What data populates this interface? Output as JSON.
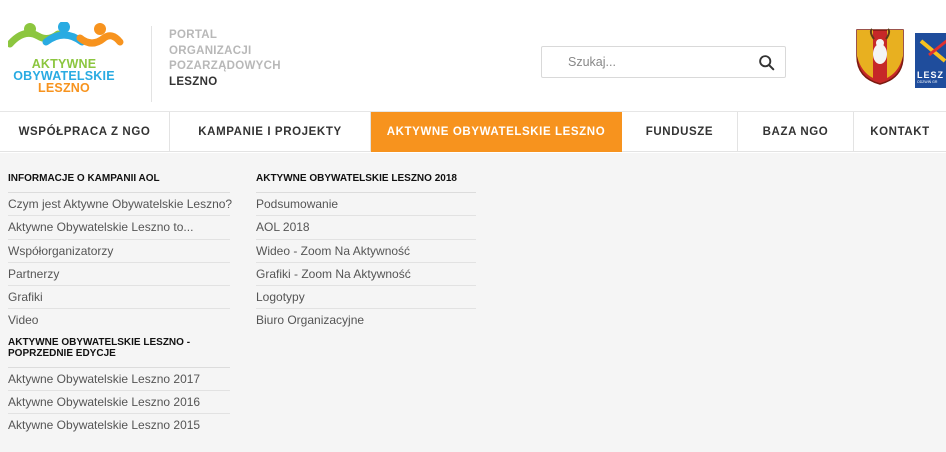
{
  "logo": {
    "line1": "AKTYWNE",
    "line2": "OBYWATELSKIE",
    "line3": "LESZNO",
    "colors": {
      "green": "#8cc63f",
      "blue": "#29abe2",
      "orange": "#f7931e"
    }
  },
  "portal": {
    "line1": "PORTAL",
    "line2": "ORGANIZACJI",
    "line3": "POZARZĄDOWYCH",
    "line4": "LESZNO"
  },
  "search": {
    "placeholder": "Szukaj...",
    "icon": "search-icon"
  },
  "partner_logo": {
    "text": "LESZ",
    "subtext": "ODZWIŃ GR"
  },
  "nav": {
    "accent": "#f7931e",
    "items": [
      {
        "label": "WSPÓŁPRACA Z NGO"
      },
      {
        "label": "KAMPANIE I PROJEKTY"
      },
      {
        "label": "AKTYWNE OBYWATELSKIE LESZNO",
        "active": true
      },
      {
        "label": "FUNDUSZE"
      },
      {
        "label": "BAZA NGO"
      },
      {
        "label": "KONTAKT"
      }
    ]
  },
  "dropdown": {
    "col1": {
      "heading": "INFORMACJE O KAMPANII AOL",
      "items": [
        "Czym jest Aktywne Obywatelskie Leszno?",
        "Aktywne Obywatelskie Leszno to...",
        "Współorganizatorzy",
        "Partnerzy",
        "Grafiki",
        "Video"
      ],
      "heading2_line1": "AKTYWNE OBYWATELSKIE LESZNO -",
      "heading2_line2": "POPRZEDNIE EDYCJE",
      "items2": [
        "Aktywne Obywatelskie Leszno 2017",
        "Aktywne Obywatelskie Leszno 2016",
        "Aktywne Obywatelskie Leszno 2015"
      ]
    },
    "col2": {
      "heading": "AKTYWNE OBYWATELSKIE LESZNO 2018",
      "items": [
        "Podsumowanie",
        "AOL 2018",
        "Wideo - Zoom Na Aktywność",
        "Grafiki - Zoom Na Aktywność",
        "Logotypy",
        "Biuro Organizacyjne"
      ]
    }
  }
}
